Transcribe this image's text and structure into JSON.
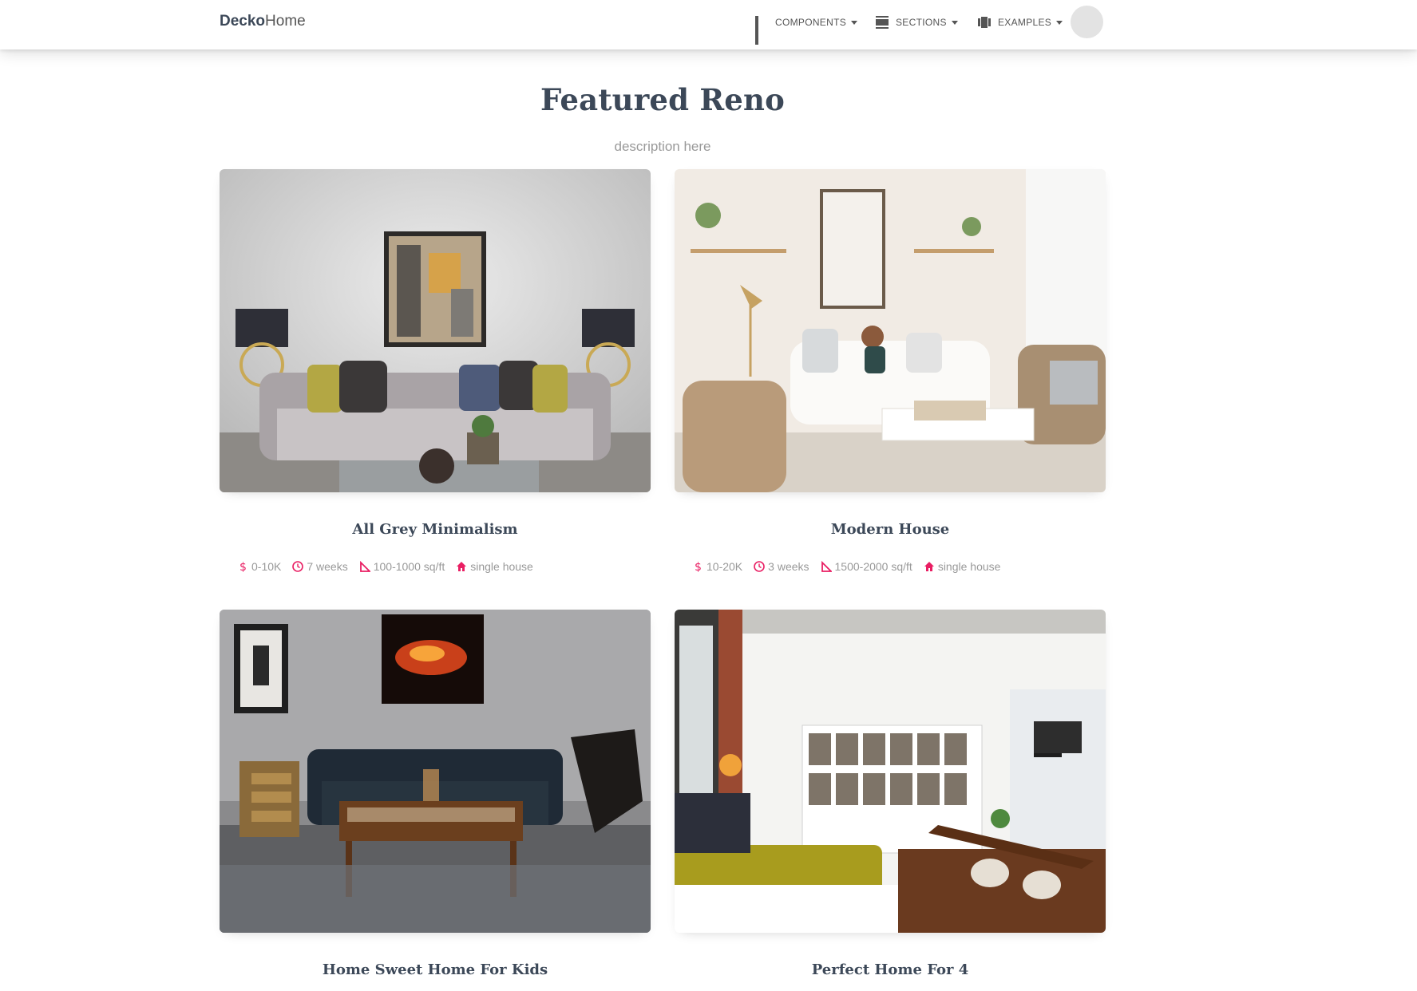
{
  "navbar": {
    "brand_bold": "Decko",
    "brand_light": "Home",
    "items": [
      {
        "label": "COMPONENTS",
        "icon": "apps-grid-icon"
      },
      {
        "label": "SECTIONS",
        "icon": "view-day-icon"
      },
      {
        "label": "EXAMPLES",
        "icon": "view-carousel-icon"
      }
    ]
  },
  "section": {
    "title": "Featured Reno",
    "description": "description here"
  },
  "cards": [
    {
      "title": "All Grey Minimalism",
      "budget": "0-10K",
      "duration": "7 weeks",
      "area": "100-1000 sq/ft",
      "type": "single house",
      "image": "grey-living-room-photo"
    },
    {
      "title": "Modern House",
      "budget": "10-20K",
      "duration": "3 weeks",
      "area": "1500-2000 sq/ft",
      "type": "single house",
      "image": "white-living-room-photo"
    },
    {
      "title": "Home Sweet Home For Kids",
      "image": "dark-lounge-photo"
    },
    {
      "title": "Perfect Home For 4",
      "image": "loft-apartment-photo"
    }
  ],
  "colors": {
    "accent": "#e91e63",
    "heading": "#3c4858",
    "muted": "#999999"
  }
}
